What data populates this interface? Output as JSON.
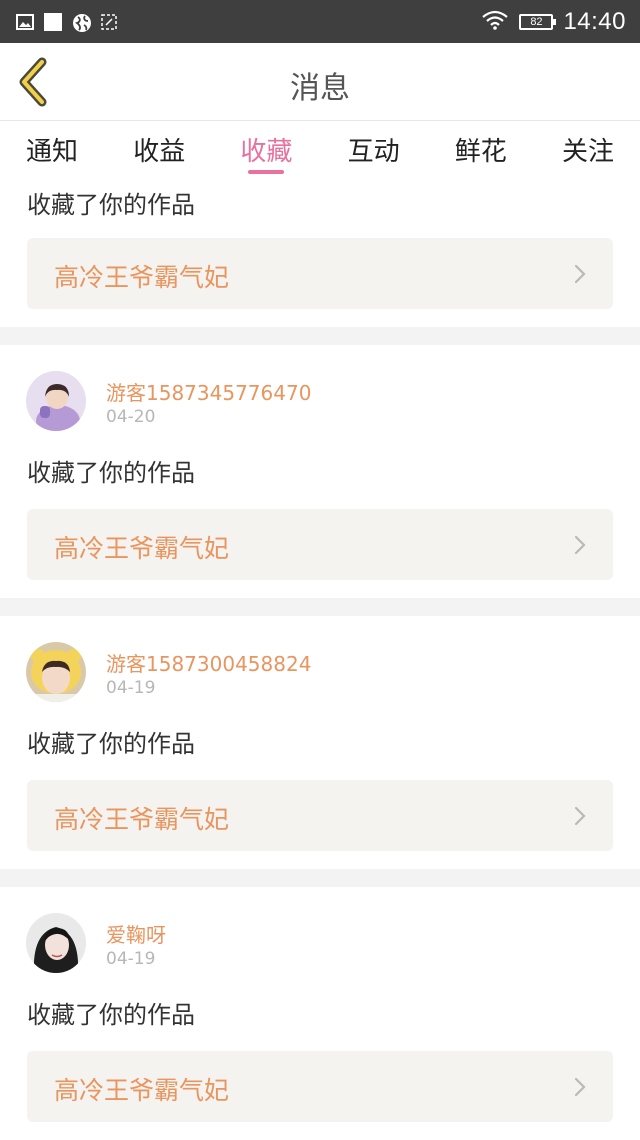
{
  "status_bar": {
    "battery": "82",
    "time": "14:40",
    "icons": [
      "image-icon",
      "square-icon",
      "globe-icon",
      "screenshot-icon",
      "wifi-icon",
      "battery-icon"
    ]
  },
  "header": {
    "title": "消息",
    "back_icon": "chevron-left-icon"
  },
  "tabs": [
    {
      "label": "通知",
      "active": false
    },
    {
      "label": "收益",
      "active": false
    },
    {
      "label": "收藏",
      "active": true
    },
    {
      "label": "互动",
      "active": false
    },
    {
      "label": "鲜花",
      "active": false
    },
    {
      "label": "关注",
      "active": false
    }
  ],
  "colors": {
    "accent_pink": "#e8719f",
    "name_orange": "#e9955f",
    "status_bar": "#3f3f3f"
  },
  "items": [
    {
      "action": "收藏了你的作品",
      "work_title": "高冷王爷霸气妃"
    },
    {
      "user": "游客1587345776470",
      "date": "04-20",
      "action": "收藏了你的作品",
      "work_title": "高冷王爷霸气妃"
    },
    {
      "user": "游客1587300458824",
      "date": "04-19",
      "action": "收藏了你的作品",
      "work_title": "高冷王爷霸气妃"
    },
    {
      "user": "爱鞠呀",
      "date": "04-19",
      "action": "收藏了你的作品",
      "work_title": "高冷王爷霸气妃"
    }
  ]
}
